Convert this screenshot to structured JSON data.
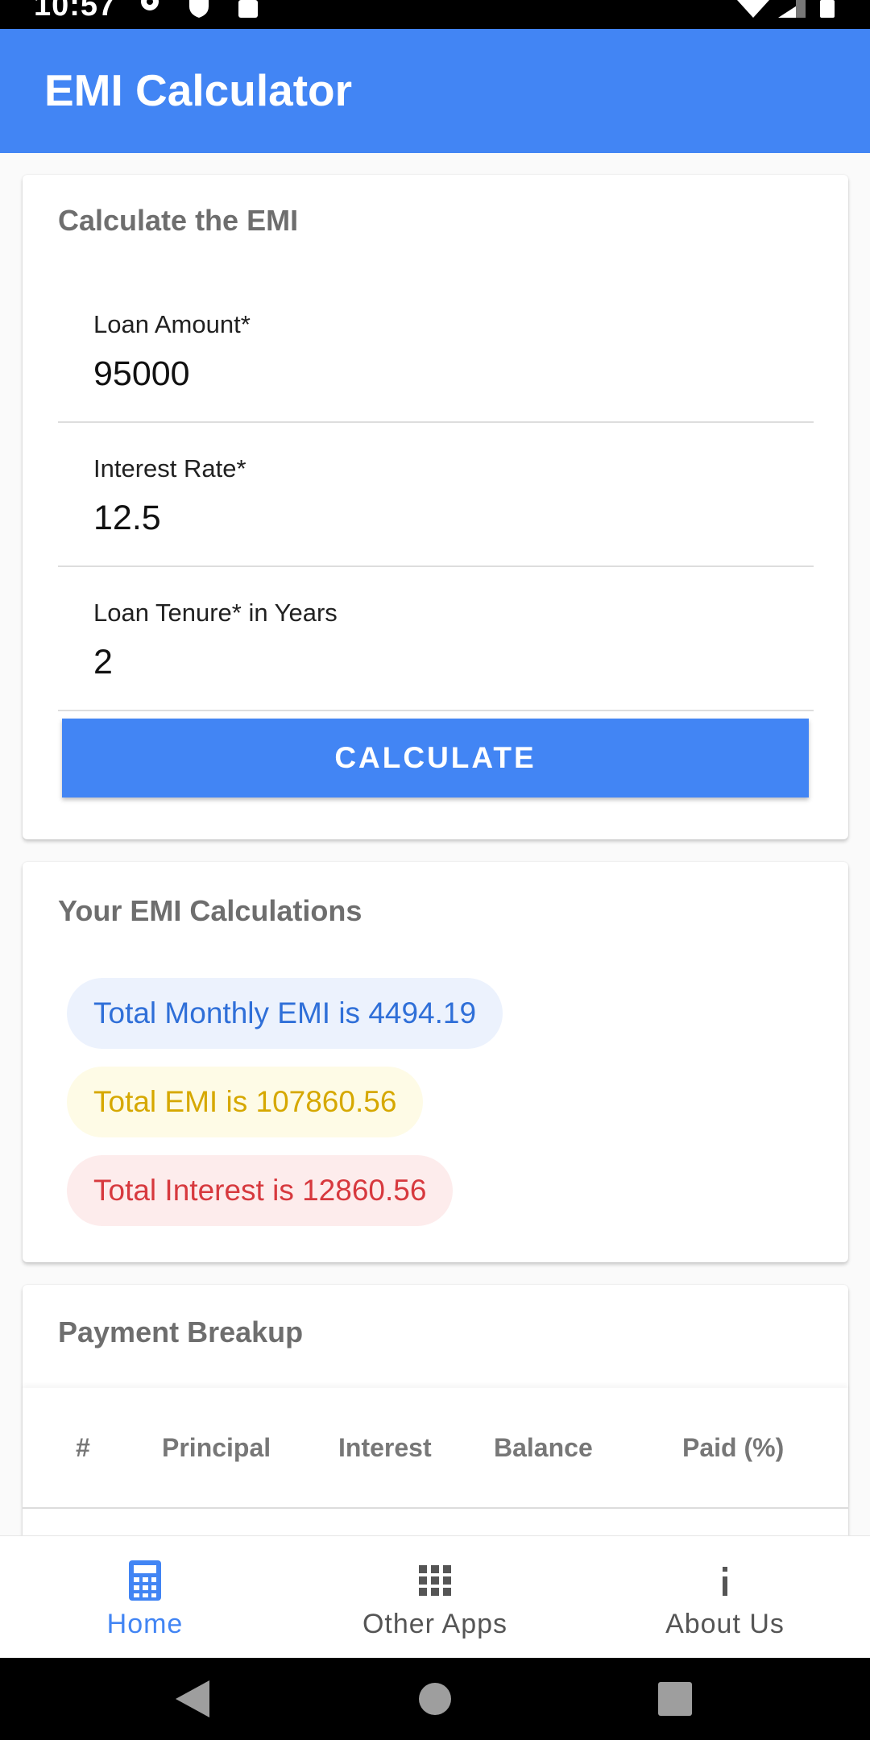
{
  "status_bar": {
    "time": "10:57"
  },
  "app_bar": {
    "title": "EMI Calculator"
  },
  "calculator_card": {
    "title": "Calculate the EMI",
    "fields": [
      {
        "label": "Loan Amount*",
        "value": "95000"
      },
      {
        "label": "Interest Rate*",
        "value": "12.5"
      },
      {
        "label": "Loan Tenure* in Years",
        "value": "2"
      }
    ],
    "button_label": "CALCULATE"
  },
  "results_card": {
    "title": "Your EMI Calculations",
    "monthly_emi": "Total Monthly EMI is 4494.19",
    "total_emi": "Total EMI is 107860.56",
    "total_interest": "Total Interest is 12860.56"
  },
  "breakup_card": {
    "title": "Payment Breakup",
    "columns": [
      "#",
      "Principal",
      "Interest",
      "Balance",
      "Paid (%)"
    ]
  },
  "bottom_nav": {
    "items": [
      {
        "label": "Home",
        "icon": "calculator-icon",
        "active": true
      },
      {
        "label": "Other Apps",
        "icon": "apps-grid-icon",
        "active": false
      },
      {
        "label": "About Us",
        "icon": "info-icon",
        "active": false
      }
    ]
  },
  "colors": {
    "primary": "#4285f4",
    "monthly_emi": "#2f6fd8",
    "total_emi": "#d6a800",
    "total_interest": "#d7393e",
    "nav_inactive": "#555555"
  }
}
